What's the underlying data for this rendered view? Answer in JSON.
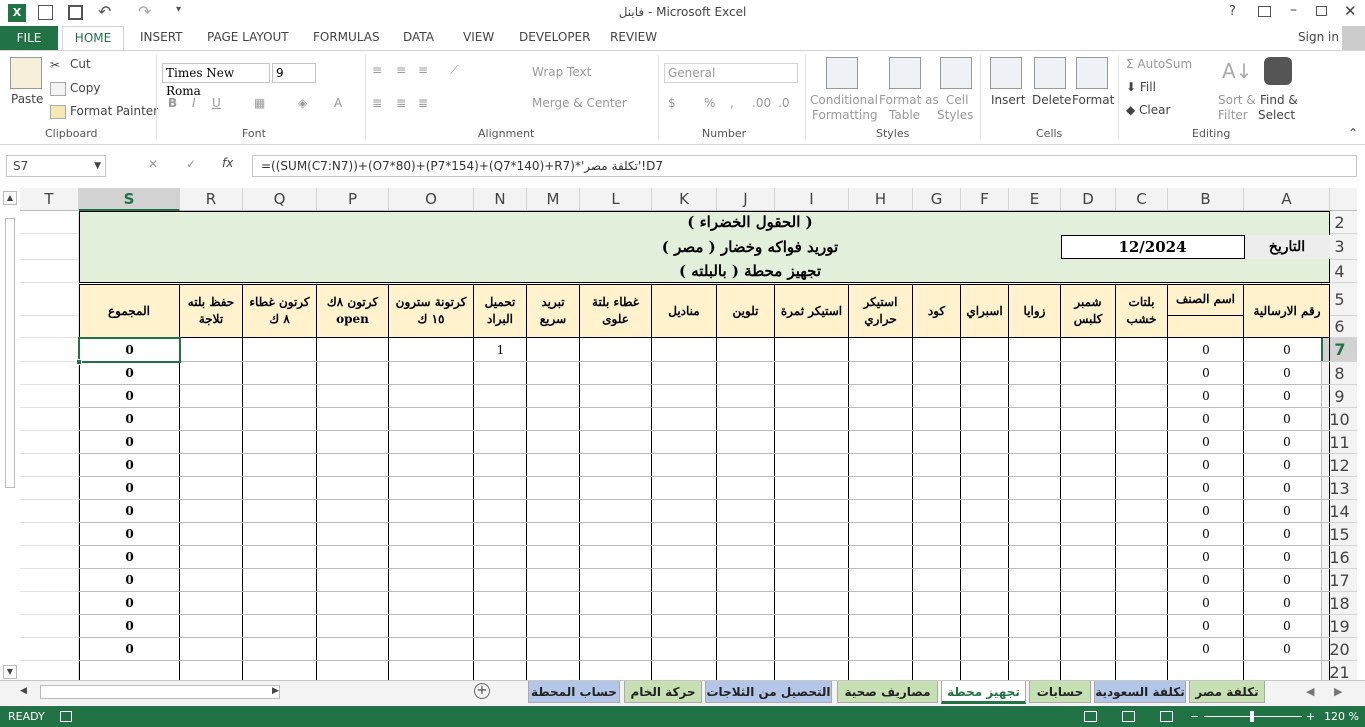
{
  "title": "فاينل - Microsoft Excel",
  "sign_in": "Sign in",
  "tabs": [
    "FILE",
    "HOME",
    "INSERT",
    "PAGE LAYOUT",
    "FORMULAS",
    "DATA",
    "VIEW",
    "DEVELOPER",
    "REVIEW"
  ],
  "ribbon": {
    "paste": "Paste",
    "cut": "Cut",
    "copy": "Copy",
    "format_painter": "Format Painter",
    "clipboard": "Clipboard",
    "font_name": "Times New Roma",
    "font_size": "9",
    "font": "Font",
    "wrap_text": "Wrap Text",
    "merge_center": "Merge & Center",
    "alignment": "Alignment",
    "number_format": "General",
    "number": "Number",
    "conditional": "Conditional",
    "formatting": "Formatting",
    "format_as": "Format as",
    "table": "Table",
    "cell": "Cell",
    "cell_styles": "Styles",
    "styles": "Styles",
    "insert": "Insert",
    "delete": "Delete",
    "format": "Format",
    "cells": "Cells",
    "autosum": "AutoSum",
    "fill": "Fill",
    "clear": "Clear",
    "sort": "Sort &",
    "filter": "Filter",
    "find": "Find &",
    "select": "Select",
    "editing": "Editing"
  },
  "name_box": "S7",
  "formula": "=((SUM(C7:N7))+(O7*80)+(P7*154)+(Q7*140)+R7)*'تكلفة مصر'!D7",
  "columns": [
    "T",
    "S",
    "R",
    "Q",
    "P",
    "O",
    "N",
    "M",
    "L",
    "K",
    "J",
    "I",
    "H",
    "G",
    "F",
    "E",
    "D",
    "C",
    "B",
    "A"
  ],
  "rows": [
    "2",
    "3",
    "4",
    "5",
    "6",
    "7",
    "8",
    "9",
    "10",
    "11",
    "12",
    "13",
    "14",
    "15",
    "16",
    "17",
    "18",
    "19",
    "20",
    "21"
  ],
  "sheet": {
    "title1": "( الحقول الخضراء )",
    "title2": "توريد فواكه وخضار   ( مصر )",
    "title3": "تجهيز محطة ( بالبلته )",
    "date_label": "التاريخ",
    "date_value": "12/2024",
    "headers": {
      "S": "المجموع",
      "R": "حفظ بلته\nتلاجة",
      "Q": "كرتون غطاء\n٨ ك",
      "P": "كرتون   ٨ك\nopen",
      "O": "كرتونة سترون\n١٥ ك",
      "N": "تحميل\nالبراد",
      "M": "تبريد\nسريع",
      "L": "غطاء بلتة\nعلوى",
      "K": "مناديل",
      "J": "تلوين",
      "I": "استيكر ثمرة",
      "H": "استيكر\nحراري",
      "G": "كود",
      "F": "اسبراي",
      "E": "زوايا",
      "D": "شمبر\nكلبس",
      "C": "بلتات\nخشب",
      "B": "اسم الصنف",
      "A": "رقم الارسالية"
    },
    "s_values": [
      "0",
      "0",
      "0",
      "0",
      "0",
      "0",
      "0",
      "0",
      "0",
      "0",
      "0",
      "0",
      "0",
      "0"
    ],
    "b_values": [
      "0",
      "0",
      "0",
      "0",
      "0",
      "0",
      "0",
      "0",
      "0",
      "0",
      "0",
      "0",
      "0",
      "0"
    ],
    "a_values": [
      "0",
      "0",
      "0",
      "0",
      "0",
      "0",
      "0",
      "0",
      "0",
      "0",
      "0",
      "0",
      "0",
      "0"
    ],
    "n7": "1"
  },
  "sheet_tabs": [
    "حساب المحطة",
    "حركة الخام",
    "التحصيل من الثلاجات",
    "مصاريف صحية",
    "تجهيز محطة",
    "حسابات",
    "تكلفة السعودية",
    "تكلفة مصر"
  ],
  "sheet_tab_colors": [
    "#b4c6e7",
    "#c6e0b4",
    "#b4c6e7",
    "#c6e0b4",
    "#ffffff",
    "#c6e0b4",
    "#b4c6e7",
    "#c6e0b4"
  ],
  "status": "READY",
  "zoom": "120 %",
  "colors": {
    "accent": "#217346",
    "green_band": "#e2efda",
    "header_yellow": "#fff2cc"
  }
}
